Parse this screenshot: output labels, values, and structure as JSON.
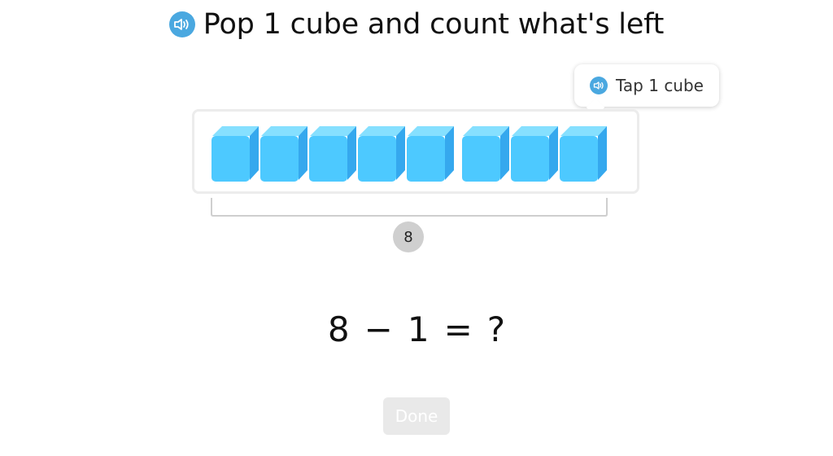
{
  "title": {
    "text": "Pop 1 cube and count what's left",
    "icon": "speaker-icon"
  },
  "tooltip": {
    "text": "Tap 1 cube",
    "icon": "speaker-icon"
  },
  "cubes": {
    "count": 8,
    "color": "#4dc9ff"
  },
  "count_badge": "8",
  "equation": {
    "a": "8",
    "op": "−",
    "b": "1",
    "eq": "=",
    "answer": "?"
  },
  "done_button": {
    "label": "Done"
  },
  "colors": {
    "speaker": "#4aa8e0",
    "cube_front": "#4dc9ff",
    "cube_top": "#86e0ff",
    "cube_side": "#35a8ee",
    "disabled_button": "#e9e9e9"
  }
}
